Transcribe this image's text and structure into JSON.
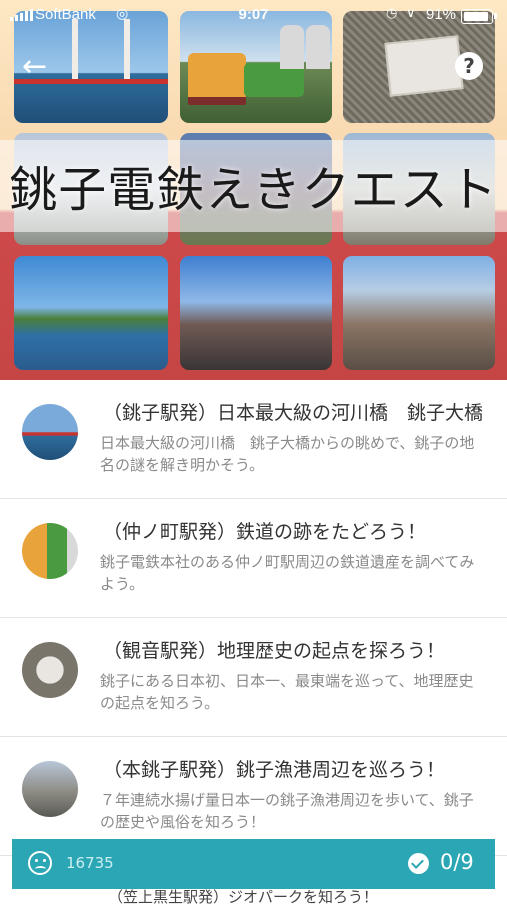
{
  "status_bar": {
    "carrier": "SoftBank",
    "time": "9:07",
    "battery_percent": "91%",
    "battery_level": 0.91
  },
  "hero": {
    "title": "銚子電鉄えきクエスト",
    "back_icon": "back-arrow-icon",
    "help_label": "?"
  },
  "quests": [
    {
      "title": "（銚子駅発）日本最大級の河川橋　銚子大橋",
      "description": "日本最大級の河川橋　銚子大橋からの眺めで、銚子の地名の謎を解き明かそう。"
    },
    {
      "title": "（仲ノ町駅発）鉄道の跡をたどろう！",
      "description": "銚子電鉄本社のある仲ノ町駅周辺の鉄道遺産を調べてみよう。"
    },
    {
      "title": "（観音駅発）地理歴史の起点を探ろう！",
      "description": "銚子にある日本初、日本一、最東端を巡って、地理歴史の起点を知ろう。"
    }
  ],
  "quest_four": {
    "title": "（本銚子駅発）銚子漁港周辺を巡ろう！",
    "description": "７年連続水揚げ量日本一の銚子漁港周辺を歩いて、銚子の歴史や風俗を知ろう！"
  },
  "next_peek": "（笠上黒生駅発）ジオパークを知ろう！",
  "footer": {
    "score": "16735",
    "progress": "0/9",
    "accent_color": "#2ba6b4"
  }
}
